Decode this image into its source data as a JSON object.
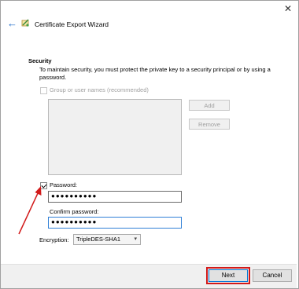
{
  "window": {
    "close_glyph": "✕",
    "back_glyph": "←",
    "title": "Certificate Export Wizard"
  },
  "security": {
    "heading": "Security",
    "description": "To maintain security, you must protect the private key to a security principal or by using a password.",
    "group_checkbox_label": "Group or user names (recommended)",
    "group_checkbox_checked": false,
    "add_button": "Add",
    "remove_button": "Remove",
    "password_checkbox_label": "Password:",
    "password_checkbox_checked": true,
    "password_value": "●●●●●●●●●●",
    "confirm_label": "Confirm password:",
    "confirm_value": "●●●●●●●●●●",
    "encryption_label": "Encryption:",
    "encryption_value": "TripleDES-SHA1"
  },
  "footer": {
    "next_button": "Next",
    "cancel_button": "Cancel"
  },
  "colors": {
    "annotation": "#d21a1a",
    "accent": "#0078d7",
    "back_arrow": "#1b6ac9"
  }
}
